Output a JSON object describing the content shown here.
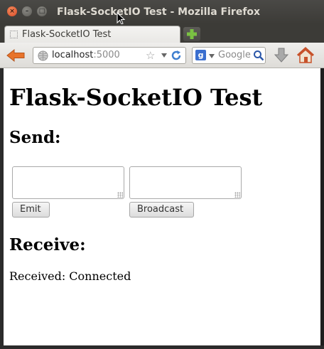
{
  "window": {
    "title": "Flask-SocketIO Test - Mozilla Firefox",
    "close_glyph": "×",
    "minimize_glyph": "–",
    "maximize_glyph": "□"
  },
  "tabs": [
    {
      "label": "Flask-SocketIO Test",
      "active": true
    }
  ],
  "new_tab_icon": "plus-icon",
  "navbar": {
    "url_host": "localhost",
    "url_port": ":5000",
    "search_placeholder": "Google",
    "search_engine_glyph": "g"
  },
  "page": {
    "title": "Flask-SocketIO Test",
    "send_heading": "Send:",
    "emit_label": "Emit",
    "broadcast_label": "Broadcast",
    "emit_input_value": "",
    "broadcast_input_value": "",
    "receive_heading": "Receive:",
    "received_text": "Received: Connected"
  },
  "colors": {
    "titlebar": "#3c3b37",
    "close_button": "#e2572f",
    "new_tab_plus": "#7ac142",
    "back_arrow": "#e8732a",
    "reload": "#3f7fcf"
  }
}
